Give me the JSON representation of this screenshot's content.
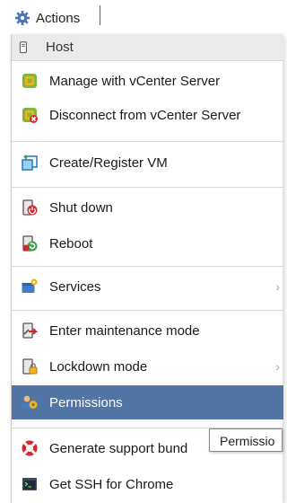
{
  "toolbar": {
    "actions_label": "Actions",
    "actions_icon": "gear-icon"
  },
  "menu": {
    "header": {
      "label": "Host",
      "icon": "host-server-icon"
    },
    "items": [
      {
        "label": "Manage with vCenter Server",
        "icon": "vcenter-manage-icon"
      },
      {
        "label": "Disconnect from vCenter Server",
        "icon": "vcenter-disconnect-icon"
      },
      {
        "label": "Create/Register VM",
        "icon": "create-vm-icon"
      },
      {
        "label": "Shut down",
        "icon": "shutdown-icon"
      },
      {
        "label": "Reboot",
        "icon": "reboot-icon"
      },
      {
        "label": "Services",
        "icon": "services-icon",
        "submenu": true
      },
      {
        "label": "Enter maintenance mode",
        "icon": "maintenance-icon"
      },
      {
        "label": "Lockdown mode",
        "icon": "lockdown-icon",
        "submenu": true
      },
      {
        "label": "Permissions",
        "icon": "permissions-icon",
        "selected": true
      },
      {
        "label": "Generate support bund",
        "icon": "support-bundle-icon"
      },
      {
        "label": "Get SSH for Chrome",
        "icon": "ssh-chrome-icon"
      }
    ]
  },
  "tooltip": {
    "text": "Permissio"
  },
  "colors": {
    "selected_bg": "#5176a6",
    "header_bg": "#eaeaea",
    "separator": "#d9d9d9",
    "caret": "#2a73c9"
  }
}
